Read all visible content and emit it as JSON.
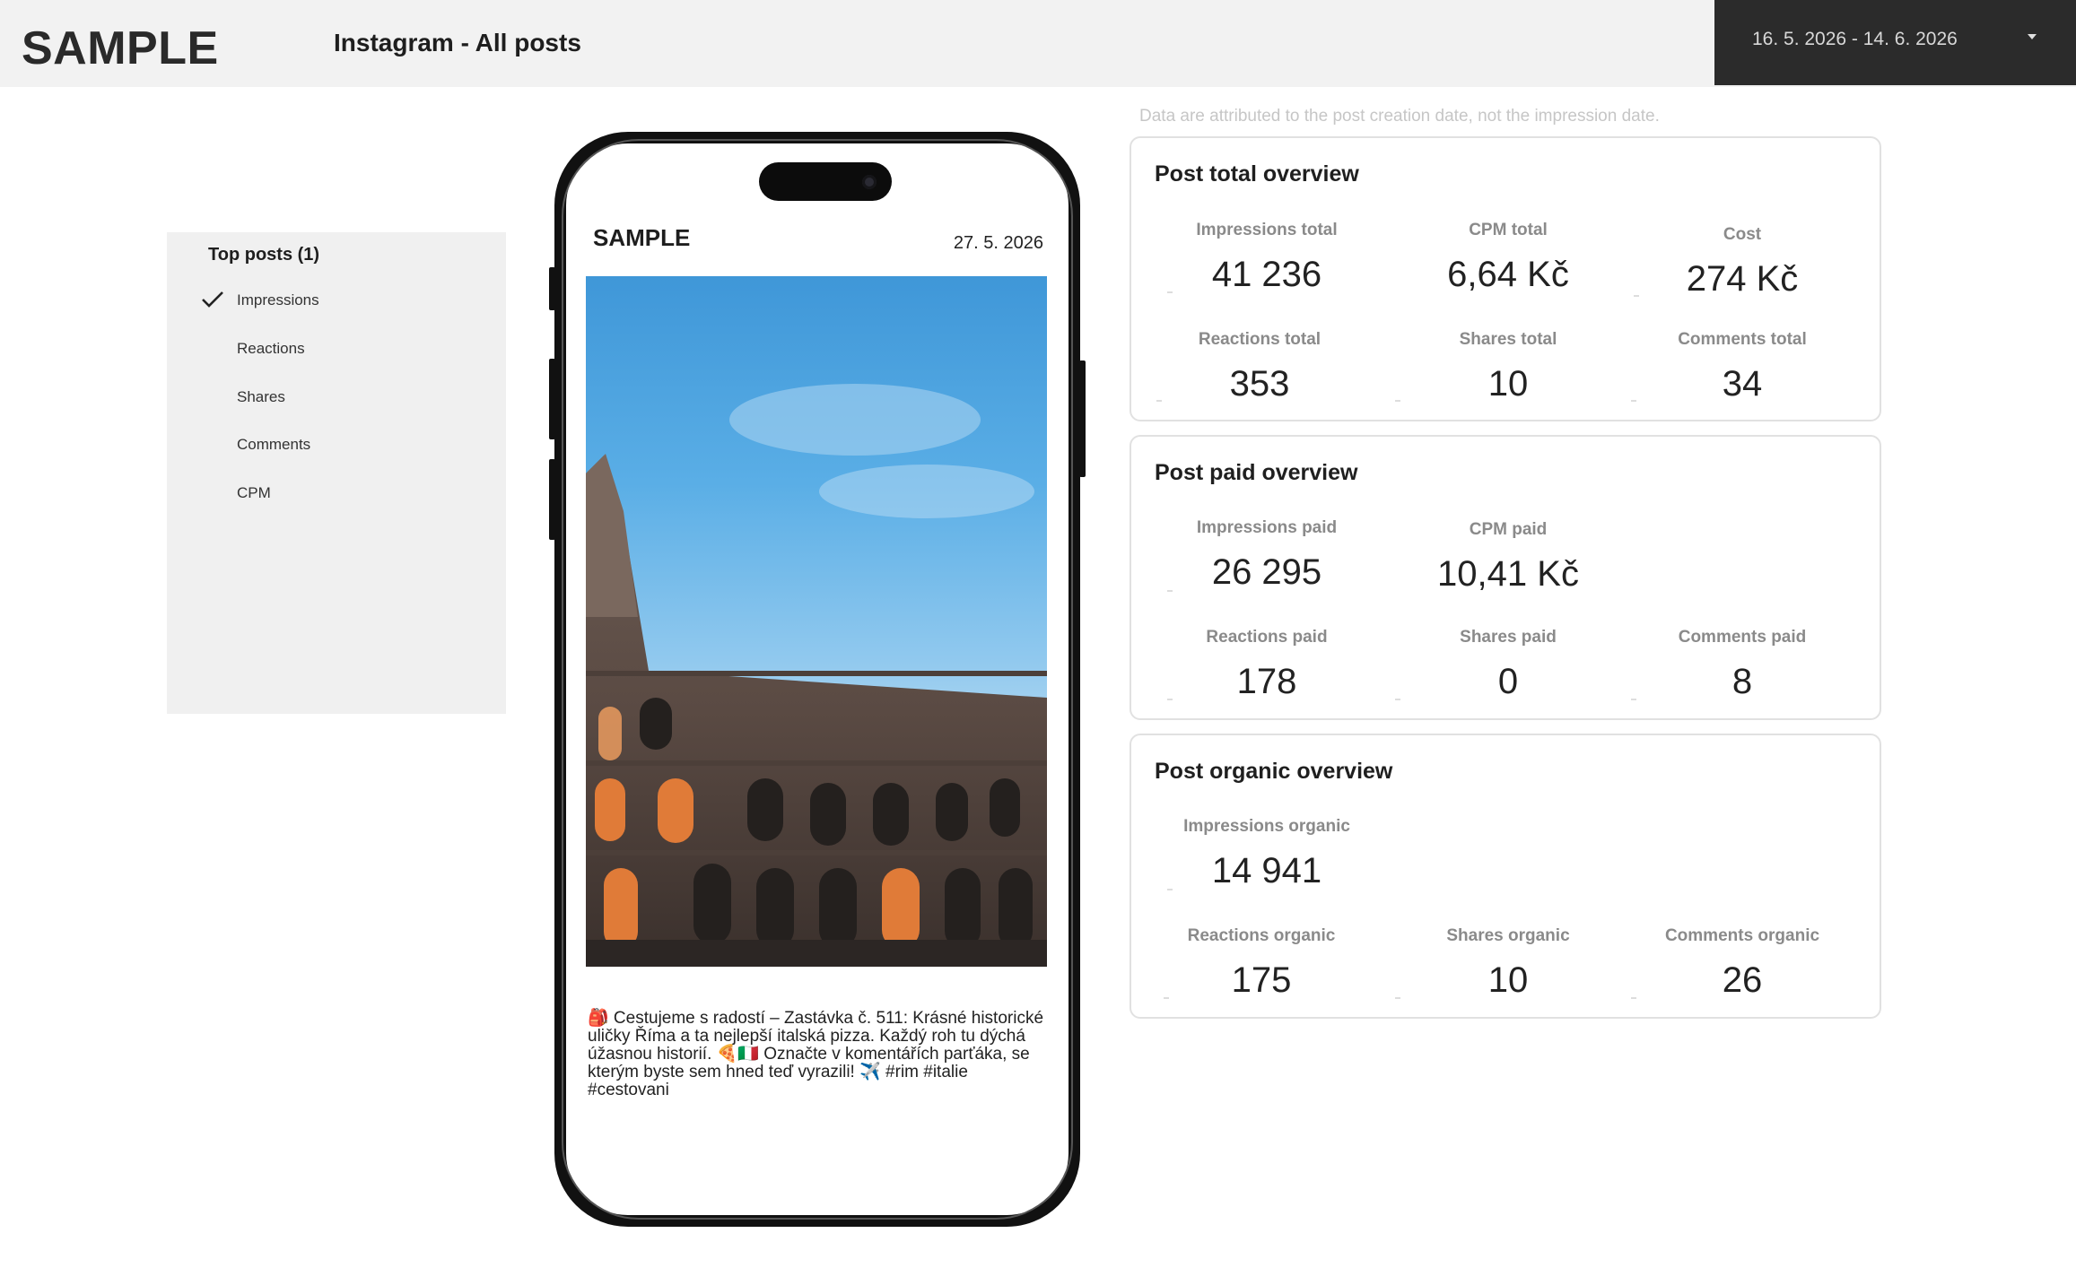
{
  "header": {
    "brand": "SAMPLE",
    "title": "Instagram - All posts",
    "date_range": "16. 5. 2026 - 14. 6. 2026"
  },
  "note": "Data are attributed to the post creation date, not the impression date.",
  "sidebar": {
    "title": "Top posts (1)",
    "selected_index": 0,
    "items": [
      {
        "label": "Impressions"
      },
      {
        "label": "Reactions"
      },
      {
        "label": "Shares"
      },
      {
        "label": "Comments"
      },
      {
        "label": "CPM"
      }
    ]
  },
  "post": {
    "brand": "SAMPLE",
    "date": "27. 5. 2026",
    "caption": "🎒 Cestujeme s radostí – Zastávka č. 511: Krásné historické uličky Říma a ta nejlepší italská pizza. Každý roh tu dýchá úžasnou historií. 🍕🇮🇹 Označte v komentářích parťáka, se kterým byste sem hned teď vyrazili! ✈️ #rim #italie #cestovani"
  },
  "overview_total": {
    "title": "Post total overview",
    "impressions_label": "Impressions total",
    "impressions_value": "41 236",
    "cpm_label": "CPM total",
    "cpm_value": "6,64 Kč",
    "cost_label": "Cost",
    "cost_value": "274 Kč",
    "reactions_label": "Reactions total",
    "reactions_value": "353",
    "shares_label": "Shares total",
    "shares_value": "10",
    "comments_label": "Comments total",
    "comments_value": "34"
  },
  "overview_paid": {
    "title": "Post paid overview",
    "impressions_label": "Impressions paid",
    "impressions_value": "26 295",
    "cpm_label": "CPM paid",
    "cpm_value": "10,41 Kč",
    "reactions_label": "Reactions paid",
    "reactions_value": "178",
    "shares_label": "Shares paid",
    "shares_value": "0",
    "comments_label": "Comments paid",
    "comments_value": "8"
  },
  "overview_organic": {
    "title": "Post organic overview",
    "impressions_label": "Impressions organic",
    "impressions_value": "14 941",
    "reactions_label": "Reactions organic",
    "reactions_value": "175",
    "shares_label": "Shares organic",
    "shares_value": "10",
    "comments_label": "Comments organic",
    "comments_value": "26"
  }
}
